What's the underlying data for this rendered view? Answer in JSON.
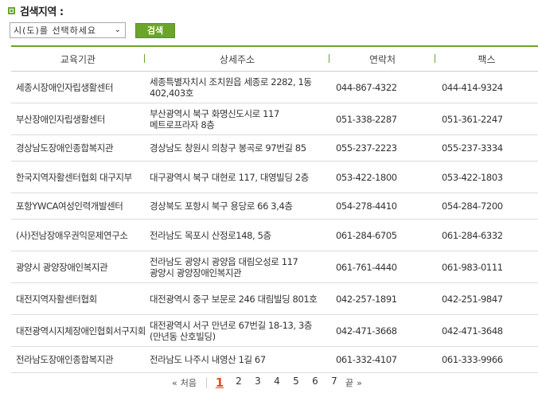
{
  "search": {
    "title": "검색지역 :",
    "select_value": "시(도)를 선택하세요",
    "button_label": "검색"
  },
  "table": {
    "headers": [
      "교육기관",
      "상세주소",
      "연락처",
      "팩스"
    ],
    "rows": [
      {
        "name": "세종시장애인자립생활센터",
        "address": "세종특별자치시 조치원읍 세종로 2282, 1동 402,403호",
        "phone": "044-867-4322",
        "fax": "044-414-9324"
      },
      {
        "name": "부산장애인자립생활센터",
        "address": "부산광역시 북구 화명신도시로 117 메트로프라자 8층",
        "phone": "051-338-2287",
        "fax": "051-361-2247"
      },
      {
        "name": "경상남도장애인종합복지관",
        "address": "경상남도 창원시 의창구 봉곡로 97번길 85",
        "phone": "055-237-2223",
        "fax": "055-237-3334"
      },
      {
        "name": "한국지역자활센터협회 대구지부",
        "address": "대구광역시 북구 대현로 117, 대영빌딩 2층",
        "phone": "053-422-1800",
        "fax": "053-422-1803"
      },
      {
        "name": "포항YWCA여성인력개발센터",
        "address": "경상북도 포항시 북구 용당로 66 3,4층",
        "phone": "054-278-4410",
        "fax": "054-284-7200"
      },
      {
        "name": "(사)전남장애우권익문제연구소",
        "address": "전라남도 목포시 산정로148, 5층",
        "phone": "061-284-6705",
        "fax": "061-284-6332"
      },
      {
        "name": "광양시 광양장애인복지관",
        "address": "전라남도 광양시 광양읍 대림오성로 117 광양시 광양장애인복지관",
        "phone": "061-761-4440",
        "fax": "061-983-0111"
      },
      {
        "name": "대전지역자활센터협회",
        "address": "대전광역시 중구 보문로 246 대림빌딩 801호",
        "phone": "042-257-1891",
        "fax": "042-251-9847"
      },
      {
        "name": "대전광역시지체장애인협회서구지회",
        "address": "대전광역시 서구 만년로 67번길 18-13, 3층 (만년동 산호빌딩)",
        "phone": "042-471-3668",
        "fax": "042-471-3648"
      },
      {
        "name": "전라남도장애인종합복지관",
        "address": "전라남도 나주시 내영산 1길 67",
        "phone": "061-332-4107",
        "fax": "061-333-9966"
      }
    ]
  },
  "pagination": {
    "first_label": "처음",
    "last_label": "끝",
    "pages": [
      "1",
      "2",
      "3",
      "4",
      "5",
      "6",
      "7"
    ],
    "current": "1"
  },
  "colors": {
    "accent": "#6aa52a",
    "current_page": "#e2511e"
  }
}
